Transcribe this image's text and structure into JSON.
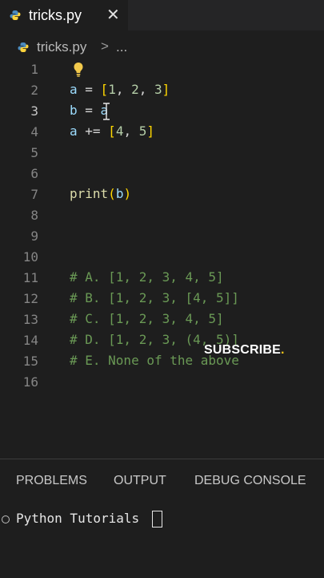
{
  "tab": {
    "label": "tricks.py",
    "close": "✕"
  },
  "breadcrumb": {
    "file": "tricks.py",
    "separator": ">",
    "more": "..."
  },
  "editor": {
    "active_line": 3,
    "lines": [
      {
        "n": "1",
        "text": ""
      },
      {
        "n": "2",
        "text": "a = [1, 2, 3]"
      },
      {
        "n": "3",
        "text": "b = a"
      },
      {
        "n": "4",
        "text": "a += [4, 5]"
      },
      {
        "n": "5",
        "text": ""
      },
      {
        "n": "6",
        "text": ""
      },
      {
        "n": "7",
        "text": "print(b)"
      },
      {
        "n": "8",
        "text": ""
      },
      {
        "n": "9",
        "text": ""
      },
      {
        "n": "10",
        "text": ""
      },
      {
        "n": "11",
        "text": "# A. [1, 2, 3, 4, 5]"
      },
      {
        "n": "12",
        "text": "# B. [1, 2, 3, [4, 5]]"
      },
      {
        "n": "13",
        "text": "# C. [1, 2, 3, 4, 5]"
      },
      {
        "n": "14",
        "text": "# D. [1, 2, 3, (4, 5)]"
      },
      {
        "n": "15",
        "text": "# E. None of the above"
      },
      {
        "n": "16",
        "text": ""
      }
    ]
  },
  "overlay": {
    "subscribe": "SUBSCRIBE",
    "dot": "."
  },
  "panel": {
    "tabs": [
      "PROBLEMS",
      "OUTPUT",
      "DEBUG CONSOLE"
    ],
    "terminal_text": "Python Tutorials"
  },
  "colors": {
    "background": "#1e1e1e",
    "comment": "#6a9955",
    "variable": "#9cdcfe",
    "number": "#b5cea8",
    "function": "#dcdcaa",
    "bracket": "#ffd700"
  },
  "icons": {
    "tab": "python-file-icon",
    "breadcrumb": "python-file-icon",
    "line1": "lightbulb-icon",
    "editor_cursor": "text-cursor-icon"
  }
}
